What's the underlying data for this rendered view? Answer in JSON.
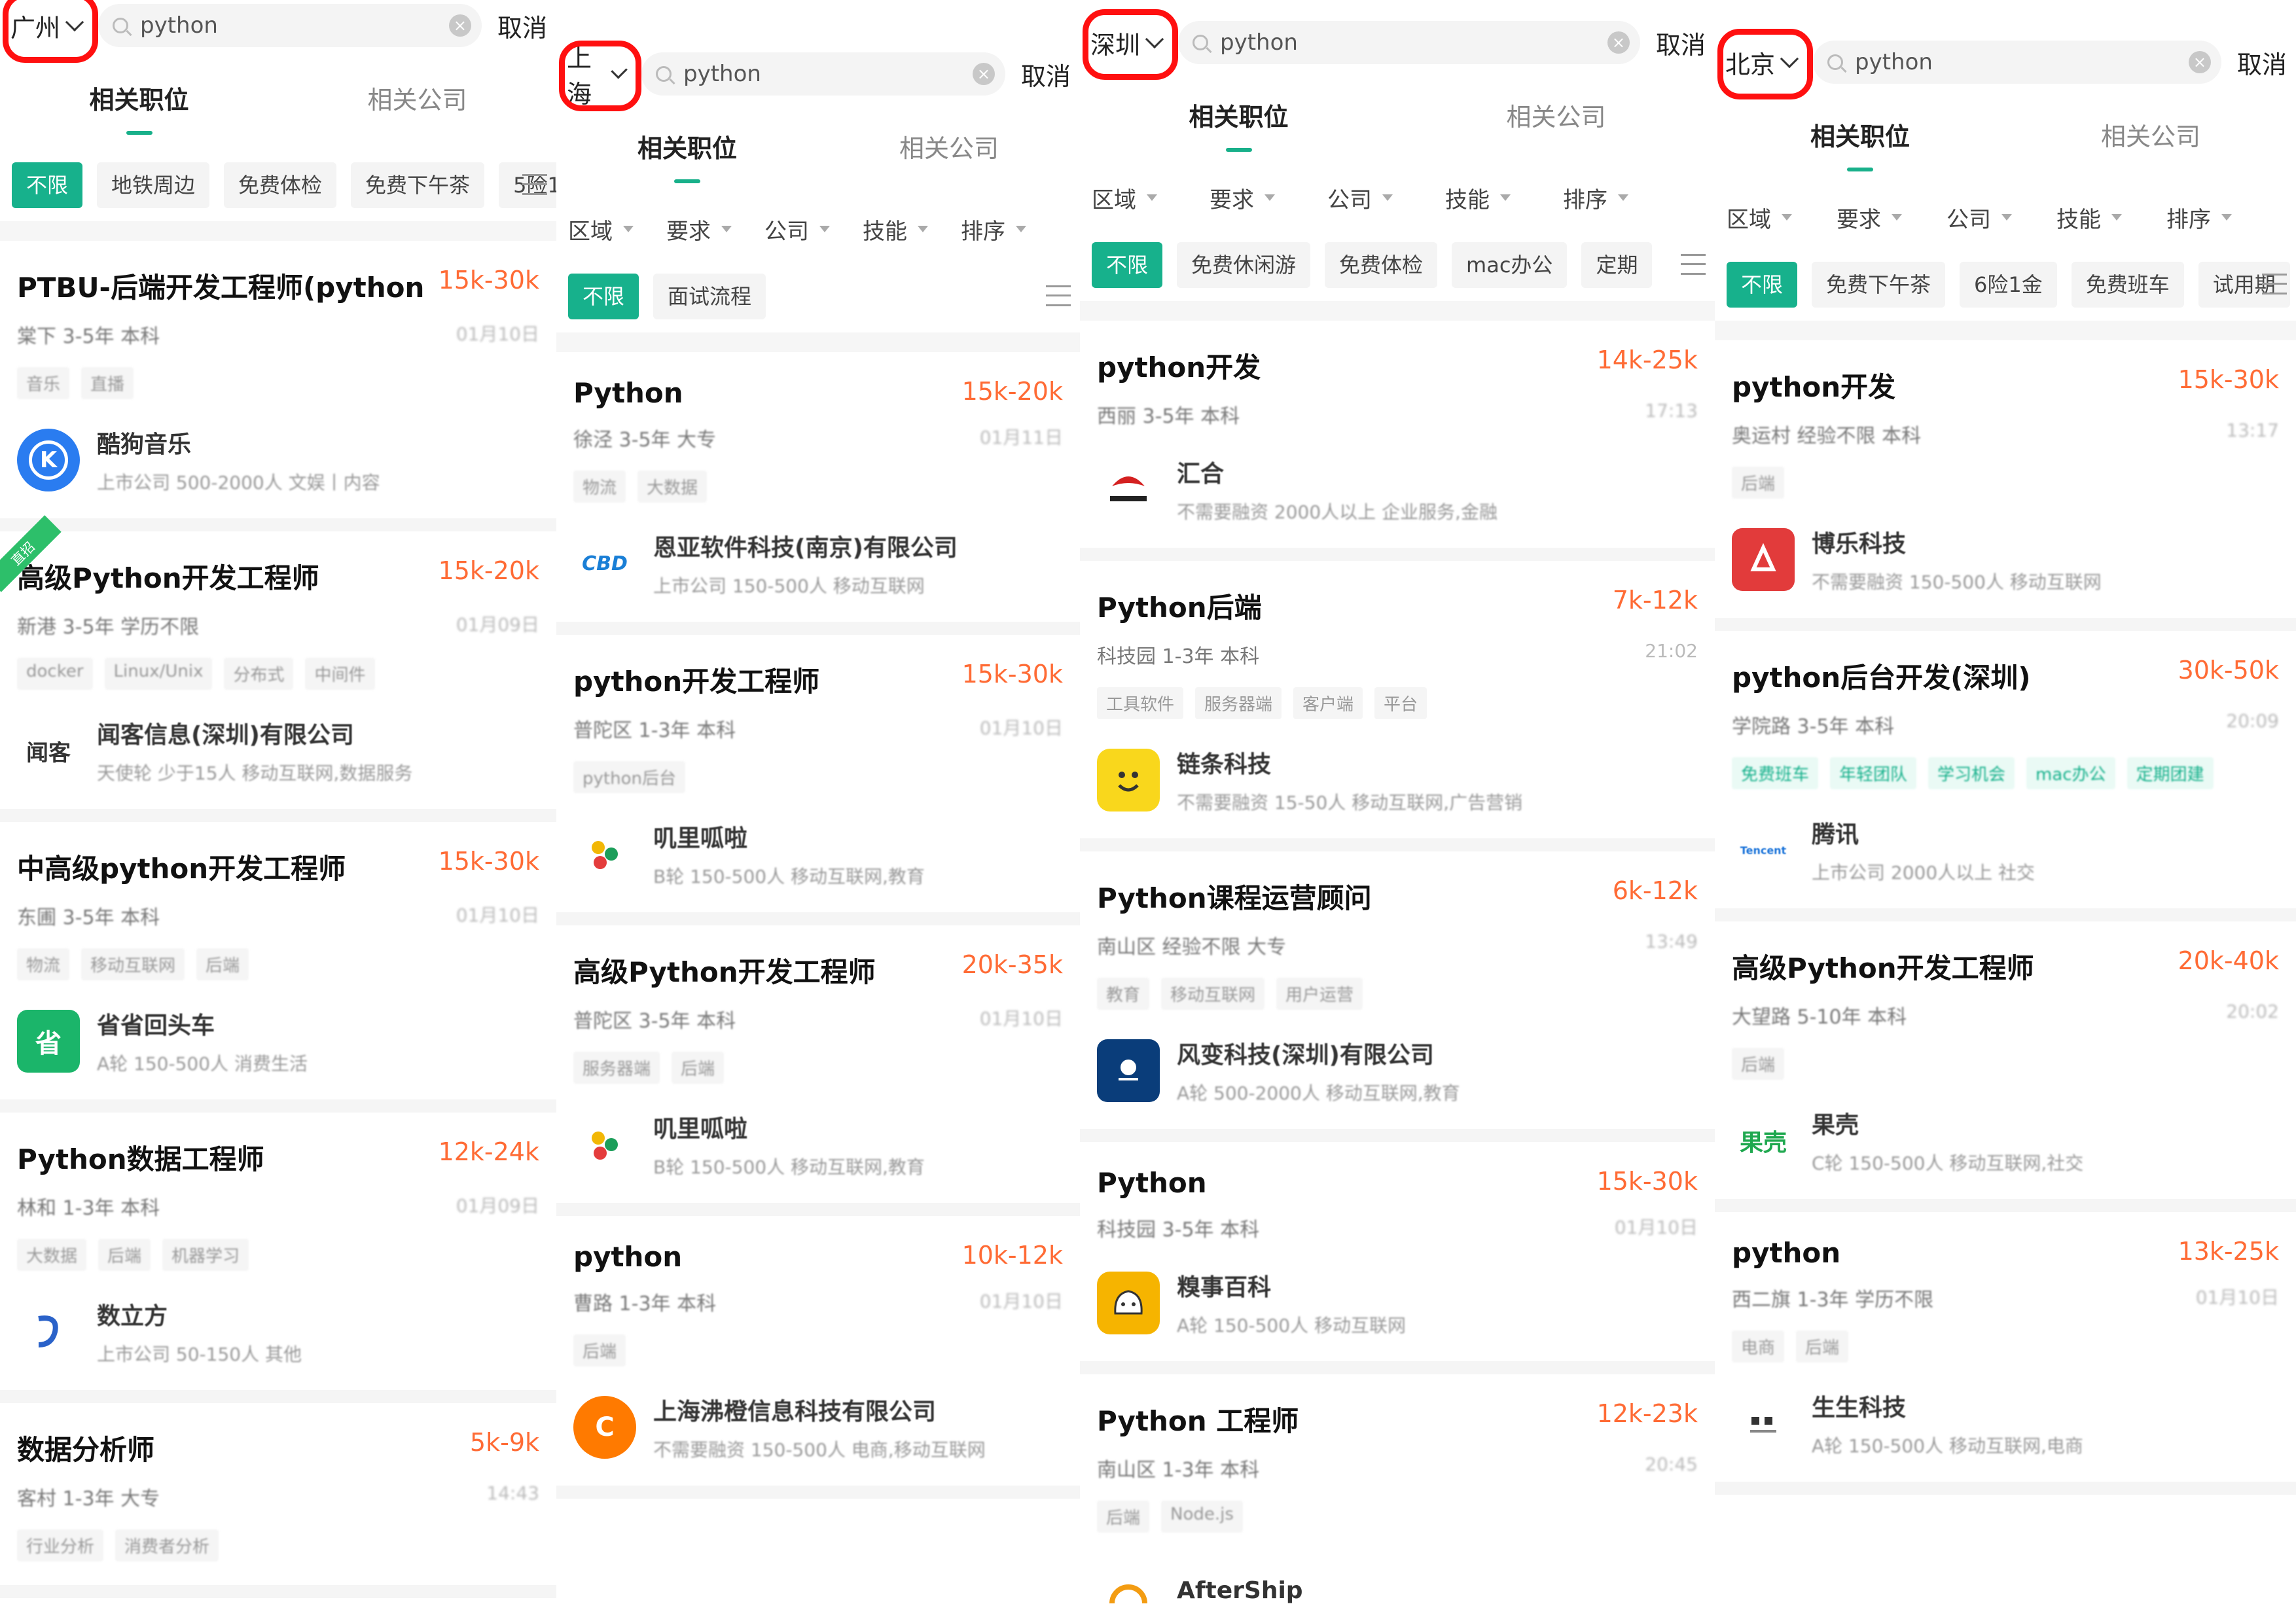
{
  "common": {
    "search_value": "python",
    "cancel_label": "取消",
    "tab_jobs": "相关职位",
    "tab_companies": "相关公司",
    "filters": [
      "区域",
      "要求",
      "公司",
      "技能",
      "排序"
    ]
  },
  "panels": [
    {
      "city": "广州",
      "chips": [
        "不限",
        "地铁周边",
        "免费体检",
        "免费下午茶",
        "5险1"
      ],
      "jobs": [
        {
          "title": "PTBU-后端开发工程师(python)",
          "salary": "15k-30k",
          "meta": "棠下 3-5年 本科",
          "time": "01月10日",
          "tags": [
            "音乐",
            "直播"
          ],
          "company": "酷狗音乐",
          "company_meta": "上市公司 500-2000人 文娱丨内容",
          "logo": "K"
        },
        {
          "title": "高级Python开发工程师",
          "salary": "15k-20k",
          "meta": "新港 3-5年 学历不限",
          "time": "01月09日",
          "tags": [
            "docker",
            "Linux/Unix",
            "分布式",
            "中间件"
          ],
          "company": "闻客信息(深圳)有限公司",
          "company_meta": "天使轮 少于15人 移动互联网,数据服务",
          "logo": "闻客",
          "ribbon": "直招"
        },
        {
          "title": "中高级python开发工程师",
          "salary": "15k-30k",
          "meta": "东圃 3-5年 本科",
          "time": "01月10日",
          "tags": [
            "物流",
            "移动互联网",
            "后端"
          ],
          "company": "省省回头车",
          "company_meta": "A轮 150-500人 消费生活",
          "logo": "省"
        },
        {
          "title": "Python数据工程师",
          "salary": "12k-24k",
          "meta": "林和 1-3年 本科",
          "time": "01月09日",
          "tags": [
            "大数据",
            "后端",
            "机器学习"
          ],
          "company": "数立方",
          "company_meta": "上市公司 50-150人 其他",
          "logo": ""
        },
        {
          "title": "数据分析师",
          "salary": "5k-9k",
          "meta": "客村 1-3年 大专",
          "time": "14:43",
          "tags": [
            "行业分析",
            "消费者分析"
          ],
          "company": "",
          "company_meta": "",
          "logo": ""
        }
      ]
    },
    {
      "city": "上海",
      "chips": [
        "不限",
        "面试流程"
      ],
      "jobs": [
        {
          "title": "Python",
          "salary": "15k-20k",
          "meta": "徐泾 3-5年 大专",
          "time": "01月11日",
          "tags": [
            "物流",
            "大数据"
          ],
          "company": "恩亚软件科技(南京)有限公司",
          "company_meta": "上市公司 150-500人 移动互联网",
          "logo": "CBD"
        },
        {
          "title": "python开发工程师",
          "salary": "15k-30k",
          "meta": "普陀区 1-3年 本科",
          "time": "01月10日",
          "tags": [
            "python后台"
          ],
          "company": "叽里呱啦",
          "company_meta": "B轮 150-500人 移动互联网,教育",
          "logo": ""
        },
        {
          "title": "高级Python开发工程师",
          "salary": "20k-35k",
          "meta": "普陀区 3-5年 本科",
          "time": "01月10日",
          "tags": [
            "服务器端",
            "后端"
          ],
          "company": "叽里呱啦",
          "company_meta": "B轮 150-500人 移动互联网,教育",
          "logo": ""
        },
        {
          "title": "python",
          "salary": "10k-12k",
          "meta": "曹路 1-3年 本科",
          "time": "01月10日",
          "tags": [
            "后端"
          ],
          "company": "上海沸橙信息科技有限公司",
          "company_meta": "不需要融资 150-500人 电商,移动互联网",
          "logo": "C"
        }
      ]
    },
    {
      "city": "深圳",
      "chips": [
        "不限",
        "免费休闲游",
        "免费体检",
        "mac办公",
        "定期"
      ],
      "jobs": [
        {
          "title": "python开发",
          "salary": "14k-25k",
          "meta": "西丽 3-5年 本科",
          "time": "17:13",
          "tags": [],
          "company": "汇合",
          "company_meta": "不需要融资 2000人以上 企业服务,金融",
          "logo": ""
        },
        {
          "title": "Python后端",
          "salary": "7k-12k",
          "meta": "科技园 1-3年 本科",
          "time": "21:02",
          "tags": [
            "工具软件",
            "服务器端",
            "客户端",
            "平台"
          ],
          "company": "链条科技",
          "company_meta": "不需要融资 15-50人 移动互联网,广告营销",
          "logo": ""
        },
        {
          "title": "Python课程运营顾问",
          "salary": "6k-12k",
          "meta": "南山区 经验不限 大专",
          "time": "13:49",
          "tags": [
            "教育",
            "移动互联网",
            "用户运营"
          ],
          "company": "风变科技(深圳)有限公司",
          "company_meta": "A轮 500-2000人 移动互联网,教育",
          "logo": ""
        },
        {
          "title": "Python",
          "salary": "15k-30k",
          "meta": "科技园 3-5年 本科",
          "time": "01月10日",
          "tags": [],
          "company": "糗事百科",
          "company_meta": "A轮 150-500人 移动互联网",
          "logo": ""
        },
        {
          "title": "Python 工程师",
          "salary": "12k-23k",
          "meta": "南山区 1-3年 本科",
          "time": "20:45",
          "tags": [
            "后端",
            "Node.js"
          ],
          "company": "AfterShip",
          "company_meta": "",
          "logo": ""
        }
      ]
    },
    {
      "city": "北京",
      "chips": [
        "不限",
        "免费下午茶",
        "6险1金",
        "免费班车",
        "试用期"
      ],
      "jobs": [
        {
          "title": "python开发",
          "salary": "15k-30k",
          "meta": "奥运村 经验不限 本科",
          "time": "13:17",
          "tags": [
            "后端"
          ],
          "company": "博乐科技",
          "company_meta": "不需要融资 150-500人 移动互联网",
          "logo": ""
        },
        {
          "title": "python后台开发(深圳)",
          "salary": "30k-50k",
          "meta": "学院路 3-5年 本科",
          "time": "20:09",
          "tags": [
            "免费班车",
            "年轻团队",
            "学习机会",
            "mac办公",
            "定期团建"
          ],
          "company": "腾讯",
          "company_meta": "上市公司 2000人以上 社交",
          "logo": "Tencent"
        },
        {
          "title": "高级Python开发工程师",
          "salary": "20k-40k",
          "meta": "大望路 5-10年 本科",
          "time": "20:02",
          "tags": [
            "后端"
          ],
          "company": "果壳",
          "company_meta": "C轮 150-500人 移动互联网,社交",
          "logo": "果壳"
        },
        {
          "title": "python",
          "salary": "13k-25k",
          "meta": "西二旗 1-3年 学历不限",
          "time": "01月10日",
          "tags": [
            "电商",
            "后端"
          ],
          "company": "生生科技",
          "company_meta": "A轮 150-500人 移动互联网,电商",
          "logo": ""
        }
      ]
    }
  ]
}
